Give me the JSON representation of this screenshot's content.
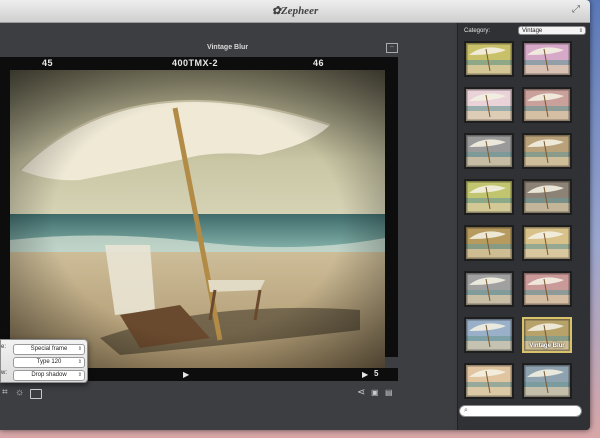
{
  "app": {
    "title": "✿Zepheer"
  },
  "main": {
    "preset_title": "Vintage Blur",
    "film": {
      "frame_left": "45",
      "film_code": "400TMX-2",
      "frame_right": "46",
      "frame_bottom": "5"
    }
  },
  "popup": {
    "rows": [
      {
        "label": "e:",
        "value": "Special frame"
      },
      {
        "label": "",
        "value": "Type 120"
      },
      {
        "label": "w:",
        "value": "Drop shadow"
      }
    ]
  },
  "sidebar": {
    "category_label": "Category:",
    "category_value": "Vintage",
    "thumbnails": [
      {
        "tint": "#c9c06a"
      },
      {
        "tint": "#d7a9c8"
      },
      {
        "tint": "#e9d2d8"
      },
      {
        "tint": "#c9a09a"
      },
      {
        "tint": "#9a9a9a"
      },
      {
        "tint": "#b9a27a"
      },
      {
        "tint": "#c2c56f"
      },
      {
        "tint": "#8c8276"
      },
      {
        "tint": "#b69a5e"
      },
      {
        "tint": "#d9c28a"
      },
      {
        "tint": "#a0a0a0"
      },
      {
        "tint": "#c99a98"
      },
      {
        "tint": "#9ab0c8"
      },
      {
        "tint": "#b7a26a",
        "label": "Vintage Blur"
      },
      {
        "tint": "#e0c5a0"
      },
      {
        "tint": "#8fa2b0"
      }
    ]
  },
  "colors": {
    "accent_selected": "#d8c26a"
  }
}
